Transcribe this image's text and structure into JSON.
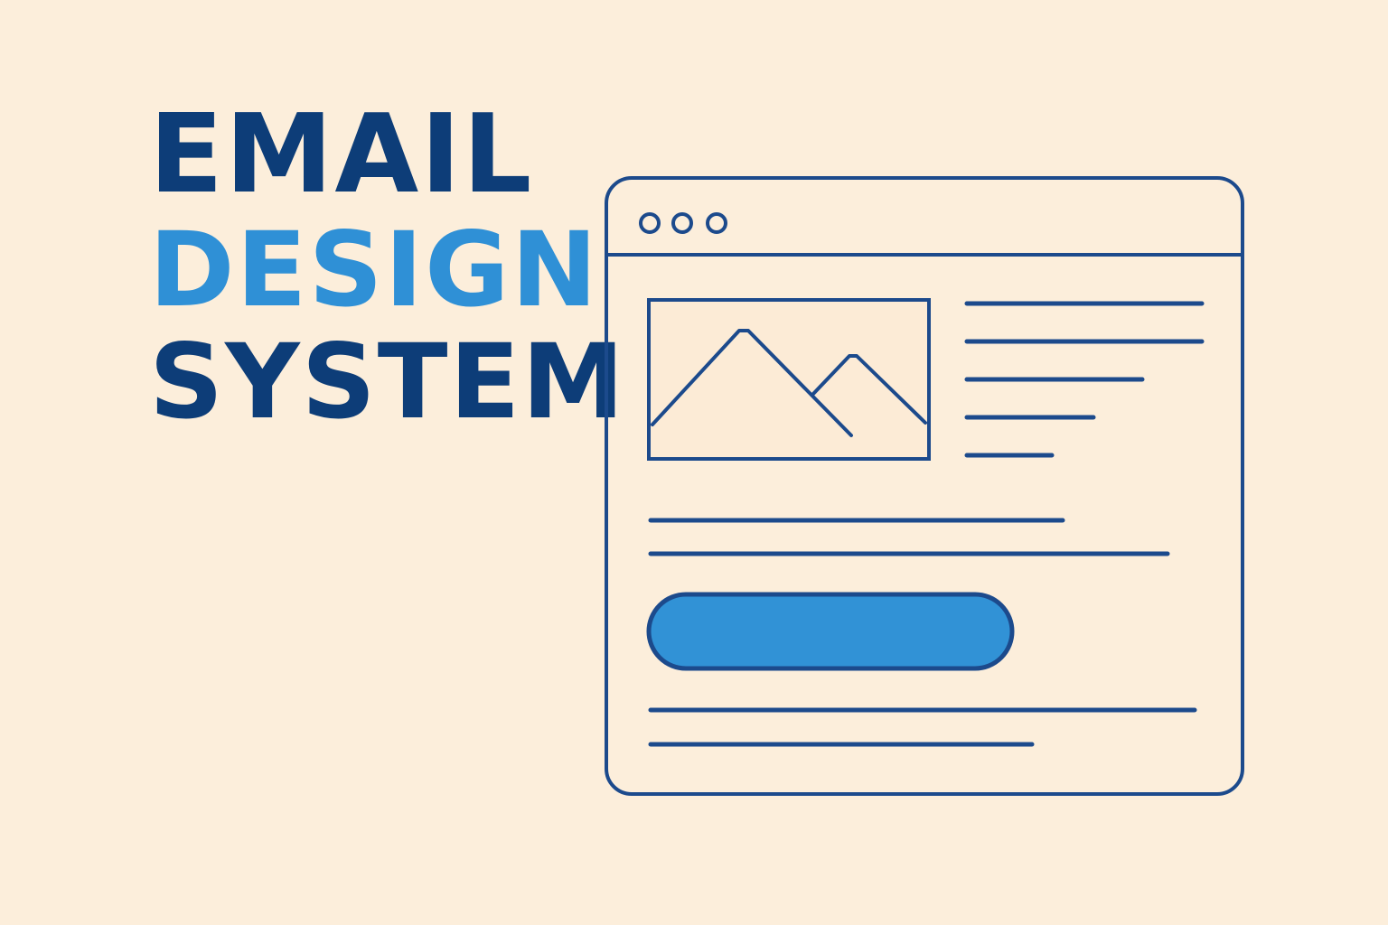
{
  "headline": {
    "line1": "EMAIL",
    "line2": "DESIGN",
    "line3": "SYSTEM"
  },
  "colors": {
    "background": "#fceedb",
    "navy": "#0d3d78",
    "accent_blue": "#2f90d6",
    "outline": "#1c4a8c"
  },
  "mockup": {
    "window_dots": [
      "dot-icon",
      "dot-icon",
      "dot-icon"
    ],
    "image_placeholder": "mountain-image-icon",
    "cta_button": "button-shape"
  }
}
